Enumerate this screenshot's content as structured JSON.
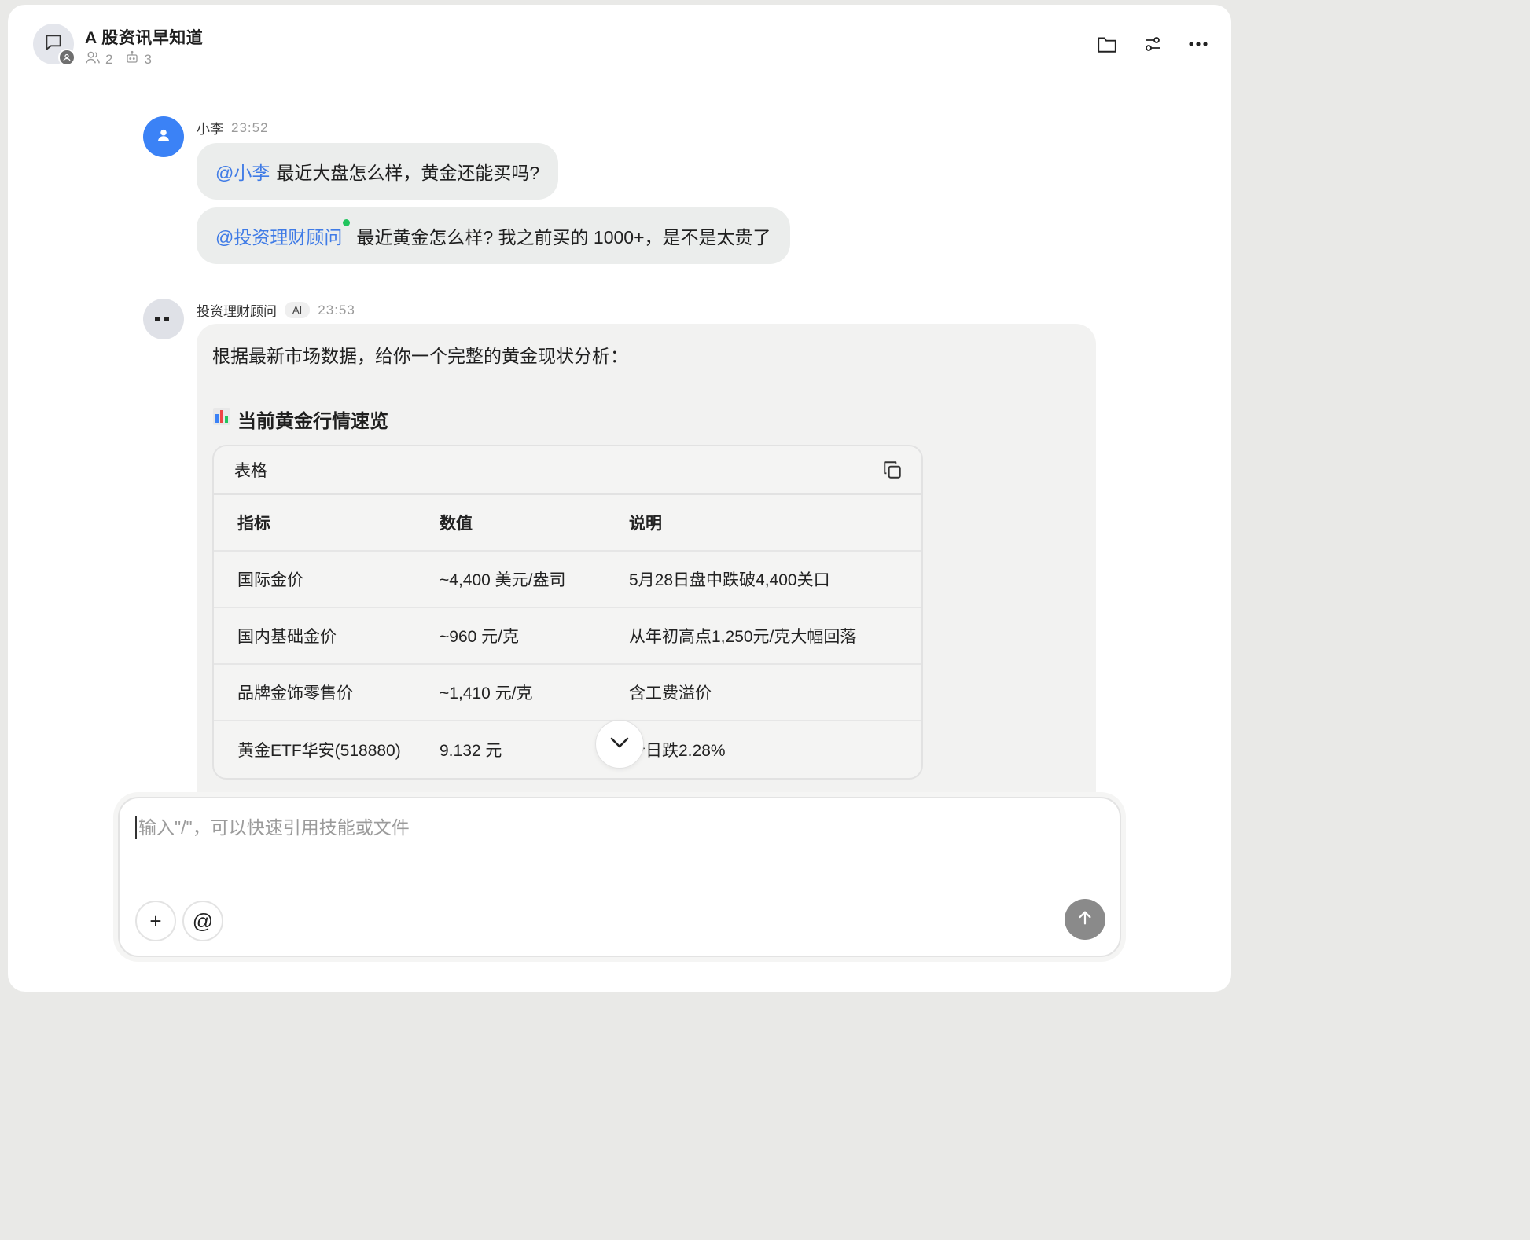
{
  "header": {
    "title": "A 股资讯早知道",
    "member_count": "2",
    "bot_count": "3"
  },
  "messages": [
    {
      "sender": "小李",
      "time": "23:52",
      "bubbles": [
        {
          "mention": "@小李",
          "text": "最近大盘怎么样，黄金还能买吗?"
        },
        {
          "mention": "@投资理财顾问",
          "text": "最近黄金怎么样? 我之前买的 1000+，是不是太贵了"
        }
      ]
    },
    {
      "sender": "投资理财顾问",
      "tag": "AI",
      "time": "23:53",
      "intro": "根据最新市场数据，给你一个完整的黄金现状分析：",
      "section_title": "当前黄金行情速览",
      "table": {
        "label": "表格",
        "headers": [
          "指标",
          "数值",
          "说明"
        ],
        "rows": [
          [
            "国际金价",
            "~4,400 美元/盎司",
            "5月28日盘中跌破4,400关口"
          ],
          [
            "国内基础金价",
            "~960 元/克",
            "从年初高点1,250元/克大幅回落"
          ],
          [
            "品牌金饰零售价",
            "~1,410 元/克",
            "含工费溢价"
          ],
          [
            "黄金ETF华安(518880)",
            "9.132 元",
            "今日跌2.28%"
          ]
        ]
      }
    }
  ],
  "composer": {
    "placeholder": "输入\"/\"，可以快速引用技能或文件",
    "add_label": "+",
    "mention_label": "@"
  },
  "colors": {
    "accent_blue": "#3f7be6",
    "avatar_blue": "#3b82f6",
    "online_green": "#22c55e",
    "send_gray": "#8a8a8a"
  }
}
